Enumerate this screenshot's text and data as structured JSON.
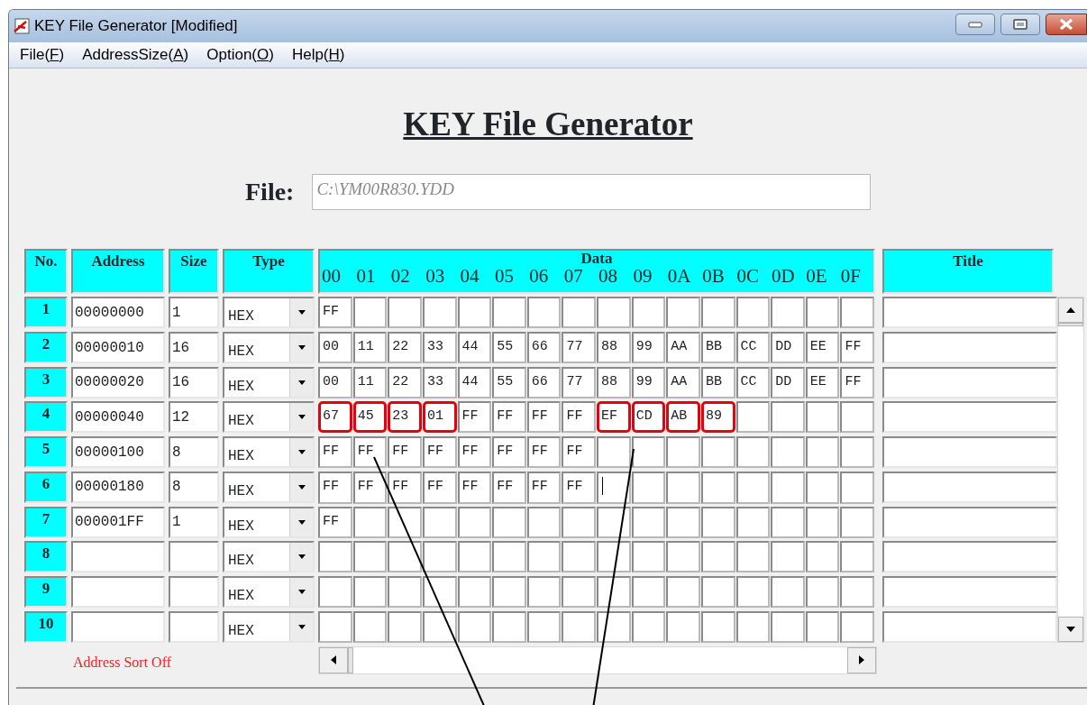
{
  "window": {
    "title": "KEY File Generator [Modified]"
  },
  "menu": [
    {
      "before": "File(",
      "mnemonic": "F",
      "after": ")"
    },
    {
      "before": "AddressSize(",
      "mnemonic": "A",
      "after": ")"
    },
    {
      "before": "Option(",
      "mnemonic": "O",
      "after": ")"
    },
    {
      "before": "Help(",
      "mnemonic": "H",
      "after": ")"
    }
  ],
  "heading": "KEY File Generator",
  "file": {
    "label": "File:",
    "value": "C:\\YM00R830.YDD",
    "disabled": true
  },
  "table": {
    "columns": [
      "No.",
      "Address",
      "Size",
      "Type",
      "Data",
      "Title"
    ],
    "data_columns": [
      "00",
      "01",
      "02",
      "03",
      "04",
      "05",
      "06",
      "07",
      "08",
      "09",
      "0A",
      "0B",
      "0C",
      "0D",
      "0E",
      "0F"
    ],
    "rows": [
      {
        "no": "1",
        "address": "00000000",
        "size": "1",
        "type": "HEX",
        "caret": false,
        "cells": [
          {
            "text": "FF",
            "outlined": false
          }
        ]
      },
      {
        "no": "2",
        "address": "00000010",
        "size": "16",
        "type": "HEX",
        "caret": false,
        "cells": [
          {
            "text": "00",
            "outlined": false
          },
          {
            "text": "11",
            "outlined": false
          },
          {
            "text": "22",
            "outlined": false
          },
          {
            "text": "33",
            "outlined": false
          },
          {
            "text": "44",
            "outlined": false
          },
          {
            "text": "55",
            "outlined": false
          },
          {
            "text": "66",
            "outlined": false
          },
          {
            "text": "77",
            "outlined": false
          },
          {
            "text": "88",
            "outlined": false
          },
          {
            "text": "99",
            "outlined": false
          },
          {
            "text": "AA",
            "outlined": false
          },
          {
            "text": "BB",
            "outlined": false
          },
          {
            "text": "CC",
            "outlined": false
          },
          {
            "text": "DD",
            "outlined": false
          },
          {
            "text": "EE",
            "outlined": false
          },
          {
            "text": "FF",
            "outlined": false
          }
        ]
      },
      {
        "no": "3",
        "address": "00000020",
        "size": "16",
        "type": "HEX",
        "caret": false,
        "cells": [
          {
            "text": "00",
            "outlined": false
          },
          {
            "text": "11",
            "outlined": false
          },
          {
            "text": "22",
            "outlined": false
          },
          {
            "text": "33",
            "outlined": false
          },
          {
            "text": "44",
            "outlined": false
          },
          {
            "text": "55",
            "outlined": false
          },
          {
            "text": "66",
            "outlined": false
          },
          {
            "text": "77",
            "outlined": false
          },
          {
            "text": "88",
            "outlined": false
          },
          {
            "text": "99",
            "outlined": false
          },
          {
            "text": "AA",
            "outlined": false
          },
          {
            "text": "BB",
            "outlined": false
          },
          {
            "text": "CC",
            "outlined": false
          },
          {
            "text": "DD",
            "outlined": false
          },
          {
            "text": "EE",
            "outlined": false
          },
          {
            "text": "FF",
            "outlined": false
          }
        ]
      },
      {
        "no": "4",
        "address": "00000040",
        "size": "12",
        "type": "HEX",
        "caret": false,
        "cells": [
          {
            "text": "67",
            "outlined": true
          },
          {
            "text": "45",
            "outlined": true
          },
          {
            "text": "23",
            "outlined": true
          },
          {
            "text": "01",
            "outlined": true
          },
          {
            "text": "FF",
            "outlined": false
          },
          {
            "text": "FF",
            "outlined": false
          },
          {
            "text": "FF",
            "outlined": false
          },
          {
            "text": "FF",
            "outlined": false
          },
          {
            "text": "EF",
            "outlined": true
          },
          {
            "text": "CD",
            "outlined": true
          },
          {
            "text": "AB",
            "outlined": true
          },
          {
            "text": "89",
            "outlined": true
          }
        ]
      },
      {
        "no": "5",
        "address": "00000100",
        "size": "8",
        "type": "HEX",
        "caret": false,
        "cells": [
          {
            "text": "FF",
            "outlined": false
          },
          {
            "text": "FF",
            "outlined": false
          },
          {
            "text": "FF",
            "outlined": false
          },
          {
            "text": "FF",
            "outlined": false
          },
          {
            "text": "FF",
            "outlined": false
          },
          {
            "text": "FF",
            "outlined": false
          },
          {
            "text": "FF",
            "outlined": false
          },
          {
            "text": "FF",
            "outlined": false
          }
        ]
      },
      {
        "no": "6",
        "address": "00000180",
        "size": "8",
        "type": "HEX",
        "caret": true,
        "cells": [
          {
            "text": "FF",
            "outlined": false
          },
          {
            "text": "FF",
            "outlined": false
          },
          {
            "text": "FF",
            "outlined": false
          },
          {
            "text": "FF",
            "outlined": false
          },
          {
            "text": "FF",
            "outlined": false
          },
          {
            "text": "FF",
            "outlined": false
          },
          {
            "text": "FF",
            "outlined": false
          },
          {
            "text": "FF",
            "outlined": false
          }
        ]
      },
      {
        "no": "7",
        "address": "000001FF",
        "size": "1",
        "type": "HEX",
        "caret": false,
        "cells": [
          {
            "text": "FF",
            "outlined": false
          }
        ]
      },
      {
        "no": "8",
        "type": "HEX",
        "caret": false
      },
      {
        "no": "9",
        "type": "HEX",
        "caret": false
      },
      {
        "no": "10",
        "type": "HEX",
        "caret": false
      }
    ]
  },
  "sort_status": "Address Sort Off"
}
